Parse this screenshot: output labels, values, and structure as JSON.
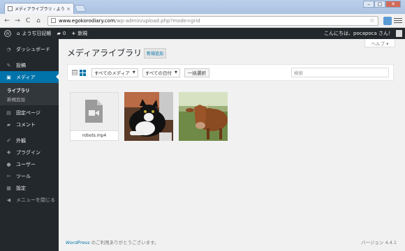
{
  "browser": {
    "tab_title": "メディアライブラリ ‹ ようぢ日記",
    "tab_close": "×",
    "url_host": "www.egokorodiary.com",
    "url_path": "/wp-admin/upload.php?mode=grid",
    "window_buttons": [
      "–",
      "□",
      "✕"
    ]
  },
  "adminbar": {
    "site_name": "ようぢ日記帳",
    "comments_count": "0",
    "new_label": "新規",
    "greeting": "こんにちは、pocapoca さん！"
  },
  "sidebar": {
    "dashboard": "ダッシュボード",
    "posts": "投稿",
    "media": "メディア",
    "media_sub": [
      "ライブラリ",
      "新規追加"
    ],
    "pages": "固定ページ",
    "comments": "コメント",
    "appearance": "外観",
    "plugins": "プラグイン",
    "users": "ユーザー",
    "tools": "ツール",
    "settings": "設定",
    "collapse": "メニューを閉じる"
  },
  "main": {
    "help": "ヘルプ ▾",
    "title": "メディアライブラリ",
    "add_new": "新規追加",
    "filter_type": "すべてのメディア",
    "filter_date": "すべての日付",
    "bulk_select": "一括選択",
    "search_placeholder": "検索",
    "video_filename": "robots.mp4"
  },
  "footer": {
    "wp_link": "WordPress",
    "thanks": " のご利用ありがとうございます。",
    "version": "バージョン 4.4.1"
  },
  "colors": {
    "accent": "#0073aa",
    "adminbar_bg": "#23282d"
  }
}
